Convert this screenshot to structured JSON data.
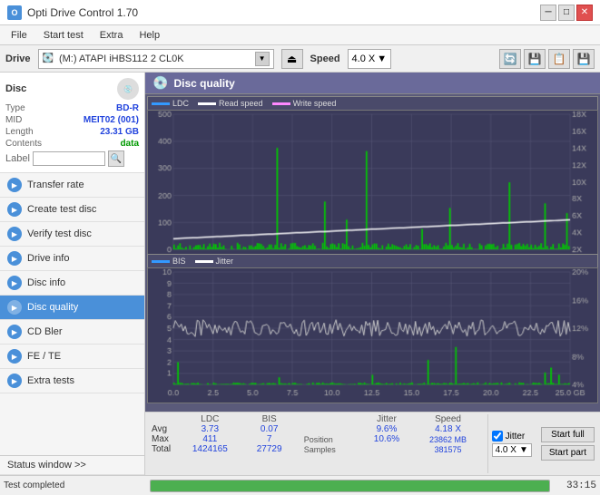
{
  "titlebar": {
    "title": "Opti Drive Control 1.70",
    "icon": "O",
    "minimize": "─",
    "maximize": "□",
    "close": "✕"
  },
  "menubar": {
    "items": [
      "File",
      "Start test",
      "Extra",
      "Help"
    ]
  },
  "drivebar": {
    "drive_label": "Drive",
    "drive_text": "(M:)  ATAPI iHBS112  2 CL0K",
    "speed_label": "Speed",
    "speed_value": "4.0 X"
  },
  "disc": {
    "header": "Disc",
    "type_label": "Type",
    "type_value": "BD-R",
    "mid_label": "MID",
    "mid_value": "MEIT02 (001)",
    "length_label": "Length",
    "length_value": "23.31 GB",
    "contents_label": "Contents",
    "contents_value": "data",
    "label_label": "Label",
    "label_value": ""
  },
  "sidebar": {
    "items": [
      {
        "id": "transfer-rate",
        "label": "Transfer rate"
      },
      {
        "id": "create-test-disc",
        "label": "Create test disc"
      },
      {
        "id": "verify-test-disc",
        "label": "Verify test disc"
      },
      {
        "id": "drive-info",
        "label": "Drive info"
      },
      {
        "id": "disc-info",
        "label": "Disc info"
      },
      {
        "id": "disc-quality",
        "label": "Disc quality",
        "active": true
      },
      {
        "id": "cd-bler",
        "label": "CD Bler"
      },
      {
        "id": "fe-te",
        "label": "FE / TE"
      },
      {
        "id": "extra-tests",
        "label": "Extra tests"
      }
    ]
  },
  "content": {
    "title": "Disc quality",
    "legend_top": [
      "LDC",
      "Read speed",
      "Write speed"
    ],
    "legend_bottom": [
      "BIS",
      "Jitter"
    ],
    "chart_top": {
      "y_max": 500,
      "y_right_labels": [
        "18X",
        "16X",
        "14X",
        "12X",
        "10X",
        "8X",
        "6X",
        "4X",
        "2X"
      ],
      "x_labels": [
        "0.0",
        "2.5",
        "5.0",
        "7.5",
        "10.0",
        "12.5",
        "15.0",
        "17.5",
        "20.0",
        "22.5",
        "25.0 GB"
      ]
    },
    "chart_bottom": {
      "y_max": 10,
      "y_right_max": "20%",
      "x_labels": [
        "0.0",
        "2.5",
        "5.0",
        "7.5",
        "10.0",
        "12.5",
        "15.0",
        "17.5",
        "20.0",
        "22.5",
        "25.0 GB"
      ]
    }
  },
  "stats": {
    "columns": [
      "LDC",
      "BIS",
      "",
      "Jitter",
      "Speed"
    ],
    "avg_label": "Avg",
    "avg_ldc": "3.73",
    "avg_bis": "0.07",
    "avg_jitter": "9.6%",
    "avg_speed": "4.18 X",
    "max_label": "Max",
    "max_ldc": "411",
    "max_bis": "7",
    "max_jitter": "10.6%",
    "max_position": "23862 MB",
    "total_label": "Total",
    "total_ldc": "1424165",
    "total_bis": "27729",
    "total_samples": "381575",
    "jitter_checked": true,
    "speed_dropdown": "4.0 X",
    "position_label": "Position",
    "samples_label": "Samples",
    "start_full": "Start full",
    "start_part": "Start part"
  },
  "status": {
    "text": "Test completed",
    "progress": 100,
    "time": "33:15",
    "status_window_label": "Status window >>"
  }
}
